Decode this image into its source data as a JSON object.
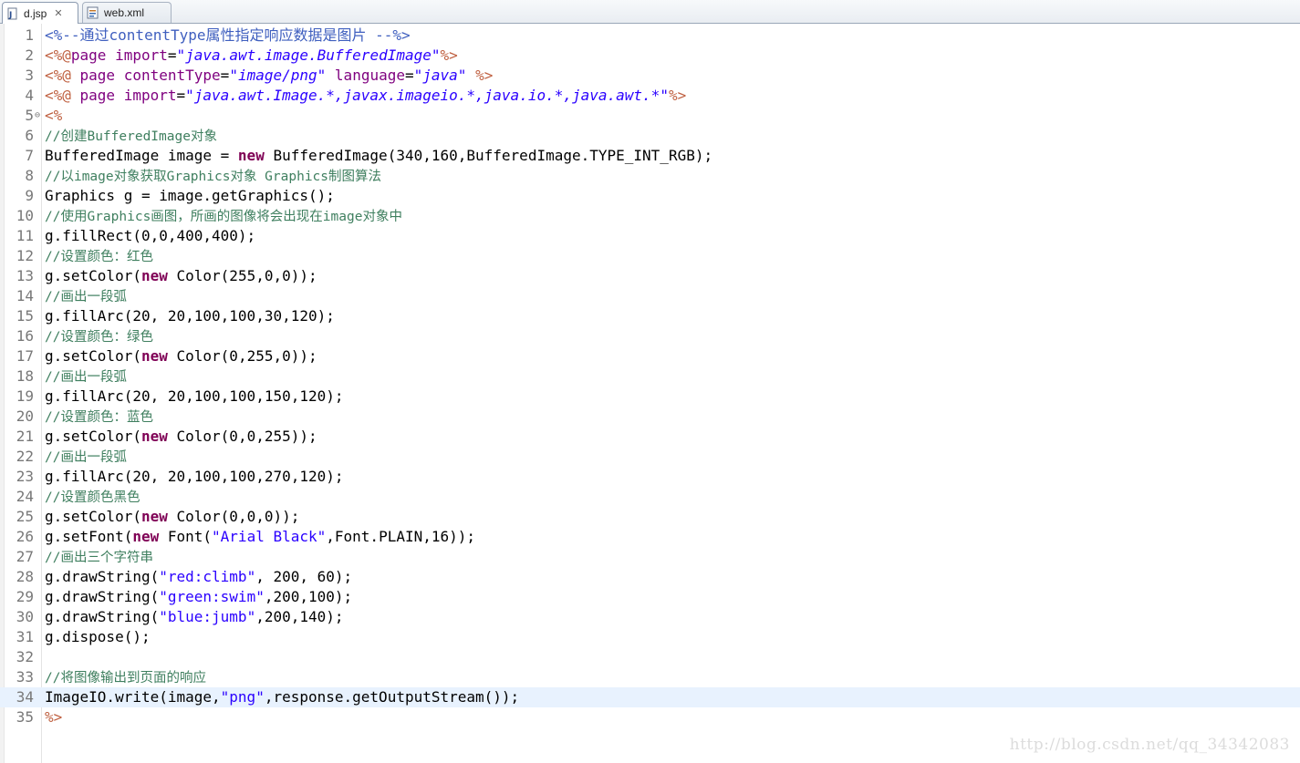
{
  "tabs": [
    {
      "label": "d.jsp",
      "icon": "jsp-file-icon",
      "active": true
    },
    {
      "label": "web.xml",
      "icon": "xml-file-icon",
      "active": false
    }
  ],
  "current_line": 34,
  "lines": [
    [
      [
        "cm",
        "<%--通过contentType属性指定响应数据是图片 --%>"
      ]
    ],
    [
      [
        "d",
        "<%@"
      ],
      [
        "a",
        "page "
      ],
      [
        "a",
        "import"
      ],
      [
        "t",
        "="
      ],
      [
        "v",
        "\"java.awt.image.BufferedImage\""
      ],
      [
        "d",
        "%>"
      ]
    ],
    [
      [
        "d",
        "<%@ "
      ],
      [
        "a",
        "page "
      ],
      [
        "a",
        "contentType"
      ],
      [
        "t",
        "="
      ],
      [
        "v",
        "\"image/png\""
      ],
      [
        "t",
        " "
      ],
      [
        "a",
        "language"
      ],
      [
        "t",
        "="
      ],
      [
        "v",
        "\"java\""
      ],
      [
        "t",
        " "
      ],
      [
        "d",
        "%>"
      ]
    ],
    [
      [
        "d",
        "<%@ "
      ],
      [
        "a",
        "page "
      ],
      [
        "a",
        "import"
      ],
      [
        "t",
        "="
      ],
      [
        "v",
        "\"java.awt.Image.*,javax.imageio.*,java.io.*,java.awt.*\""
      ],
      [
        "d",
        "%>"
      ]
    ],
    [
      [
        "d",
        "<%"
      ]
    ],
    [
      [
        "c",
        "//创建BufferedImage对象"
      ]
    ],
    [
      [
        "t",
        "BufferedImage image = "
      ],
      [
        "k",
        "new"
      ],
      [
        "t",
        " BufferedImage(340,160,BufferedImage.TYPE_INT_RGB);"
      ]
    ],
    [
      [
        "c",
        "//以image对象获取Graphics对象 Graphics制图算法"
      ]
    ],
    [
      [
        "t",
        "Graphics g = image.getGraphics();"
      ]
    ],
    [
      [
        "c",
        "//使用Graphics画图，所画的图像将会出现在image对象中"
      ]
    ],
    [
      [
        "t",
        "g.fillRect(0,0,400,400);"
      ]
    ],
    [
      [
        "c",
        "//设置颜色：红色"
      ]
    ],
    [
      [
        "t",
        "g.setColor("
      ],
      [
        "k",
        "new"
      ],
      [
        "t",
        " Color(255,0,0));"
      ]
    ],
    [
      [
        "c",
        "//画出一段弧"
      ]
    ],
    [
      [
        "t",
        "g.fillArc(20, 20,100,100,30,120);"
      ]
    ],
    [
      [
        "c",
        "//设置颜色：绿色"
      ]
    ],
    [
      [
        "t",
        "g.setColor("
      ],
      [
        "k",
        "new"
      ],
      [
        "t",
        " Color(0,255,0));"
      ]
    ],
    [
      [
        "c",
        "//画出一段弧"
      ]
    ],
    [
      [
        "t",
        "g.fillArc(20, 20,100,100,150,120);"
      ]
    ],
    [
      [
        "c",
        "//设置颜色：蓝色"
      ]
    ],
    [
      [
        "t",
        "g.setColor("
      ],
      [
        "k",
        "new"
      ],
      [
        "t",
        " Color(0,0,255));"
      ]
    ],
    [
      [
        "c",
        "//画出一段弧"
      ]
    ],
    [
      [
        "t",
        "g.fillArc(20, 20,100,100,270,120);"
      ]
    ],
    [
      [
        "c",
        "//设置颜色黑色"
      ]
    ],
    [
      [
        "t",
        "g.setColor("
      ],
      [
        "k",
        "new"
      ],
      [
        "t",
        " Color(0,0,0));"
      ]
    ],
    [
      [
        "t",
        "g.setFont("
      ],
      [
        "k",
        "new"
      ],
      [
        "t",
        " Font("
      ],
      [
        "s",
        "\"Arial Black\""
      ],
      [
        "t",
        ",Font.PLAIN,16));"
      ]
    ],
    [
      [
        "c",
        "//画出三个字符串"
      ]
    ],
    [
      [
        "t",
        "g.drawString("
      ],
      [
        "s",
        "\"red:climb\""
      ],
      [
        "t",
        ", 200, 60);"
      ]
    ],
    [
      [
        "t",
        "g.drawString("
      ],
      [
        "s",
        "\"green:swim\""
      ],
      [
        "t",
        ",200,100);"
      ]
    ],
    [
      [
        "t",
        "g.drawString("
      ],
      [
        "s",
        "\"blue:jumb\""
      ],
      [
        "t",
        ",200,140);"
      ]
    ],
    [
      [
        "t",
        "g.dispose();"
      ]
    ],
    [],
    [
      [
        "c",
        "//将图像输出到页面的响应"
      ]
    ],
    [
      [
        "t",
        "ImageIO.write(image,"
      ],
      [
        "s",
        "\"png\""
      ],
      [
        "t",
        ",response.getOutputStream());"
      ]
    ],
    [
      [
        "d",
        "%>"
      ]
    ]
  ],
  "watermark": "http://blog.csdn.net/qq_34342083"
}
